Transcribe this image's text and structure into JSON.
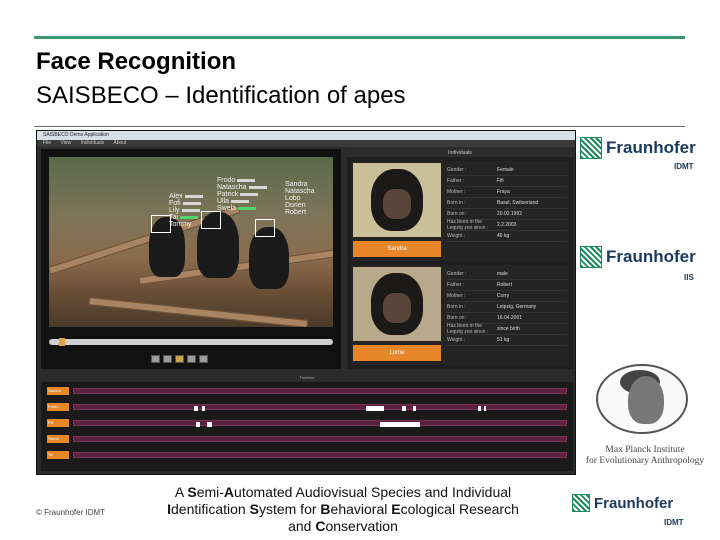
{
  "slide": {
    "title_line1": "Face Recognition",
    "title_line2": "SAISBECO – Identification of apes",
    "copyright": "© Fraunhofer IDMT",
    "footer_prefix_a": "A ",
    "footer_S": "S",
    "footer_t1": "emi-",
    "footer_A": "A",
    "footer_t2": "utomated Audiovisual Species and Individual",
    "footer_I": "I",
    "footer_t3": "dentification ",
    "footer_S2": "S",
    "footer_t4": "ystem for ",
    "footer_B": "B",
    "footer_t5": "ehavioral ",
    "footer_E": "E",
    "footer_t6": "cological Research",
    "footer_t7": "and ",
    "footer_C": "C",
    "footer_t8": "onservation"
  },
  "logos": {
    "fraunhofer": "Fraunhofer",
    "idmt": "IDMT",
    "iis": "IIS",
    "mpi_line1": "Max Planck Institute",
    "mpi_line2": "for Evolutionary Anthropology",
    "brand_color": "#1b8a5a"
  },
  "app": {
    "window_title": "SAISBECO Demo Application",
    "menu": [
      "File",
      "View",
      "Individuals",
      "About"
    ],
    "pane_title": "Individuals",
    "timeline_title": "Timeline",
    "left_tags": [
      "Alex",
      "Fofi",
      "Lily",
      "Tai",
      "Tommy"
    ],
    "right_tags": [
      "Frodo",
      "Natascha",
      "Patrick",
      "Ulla",
      "Swela"
    ],
    "far_tags": [
      "Sandra",
      "Natascha",
      "Lobo",
      "Dorien",
      "Robert"
    ],
    "cards": [
      {
        "name": "Sandra",
        "fields": [
          {
            "k": "Gender :",
            "v": "Female"
          },
          {
            "k": "Father :",
            "v": "Fifi"
          },
          {
            "k": "Mother :",
            "v": "Fraya"
          },
          {
            "k": "Born in :",
            "v": "Basel, Switzerland"
          },
          {
            "k": "Born on :",
            "v": "20.02.1992"
          },
          {
            "k": "Has been in the Leipzig zoo since :",
            "v": "2.2.2003"
          },
          {
            "k": "Weight :",
            "v": "46 kg"
          }
        ]
      },
      {
        "name": "Lome",
        "fields": [
          {
            "k": "Gender :",
            "v": "male"
          },
          {
            "k": "Father :",
            "v": "Robert"
          },
          {
            "k": "Mother :",
            "v": "Corry"
          },
          {
            "k": "Born in :",
            "v": "Leipzig, Germany"
          },
          {
            "k": "Born on :",
            "v": "16.04.2001"
          },
          {
            "k": "Has been in the Leipzig zoo since :",
            "v": "since birth"
          },
          {
            "k": "Weight :",
            "v": "51 kg"
          }
        ]
      }
    ],
    "timeline_rows": [
      "Sandra",
      "Frodo",
      "Fifi",
      "Swela",
      "Tai"
    ]
  }
}
